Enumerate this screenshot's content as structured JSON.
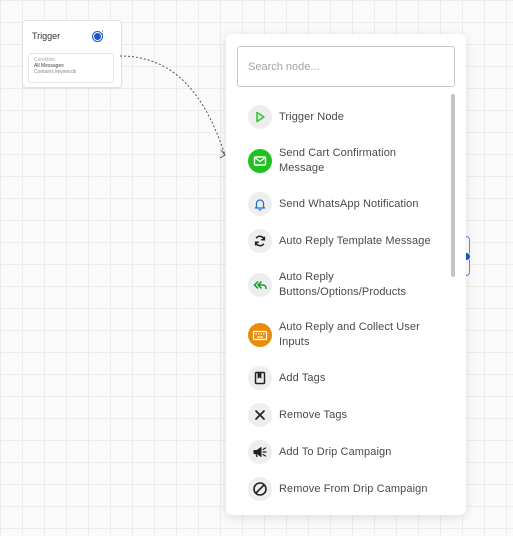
{
  "trigger_node": {
    "title": "Trigger",
    "menu_glyph": "⋮",
    "condition_label": "Condition",
    "condition_value": "All Messages",
    "condition_match": "Contains keywords"
  },
  "picker": {
    "search": {
      "placeholder": "Search node...",
      "value": ""
    },
    "items": [
      {
        "label": "Trigger Node",
        "icon": "play-icon",
        "icon_color": "#2ecc2e",
        "icon_bg": "#eeeeee"
      },
      {
        "label": "Send Cart Confirmation Message",
        "icon": "envelope-icon",
        "icon_color": "#ffffff",
        "icon_bg": "#22c122"
      },
      {
        "label": "Send WhatsApp Notification",
        "icon": "bell-icon",
        "icon_color": "#1f6fd6",
        "icon_bg": "#eeeeee"
      },
      {
        "label": "Auto Reply Template Message",
        "icon": "refresh-icon",
        "icon_color": "#222222",
        "icon_bg": "#eeeeee"
      },
      {
        "label": "Auto Reply Buttons/Options/Products",
        "icon": "reply-all-icon",
        "icon_color": "#139a2a",
        "icon_bg": "#eeeeee"
      },
      {
        "label": "Auto Reply and Collect User Inputs",
        "icon": "keyboard-icon",
        "icon_color": "#ffffff",
        "icon_bg": "#e88c0c"
      },
      {
        "label": "Add Tags",
        "icon": "tag-icon",
        "icon_color": "#222222",
        "icon_bg": "#eeeeee"
      },
      {
        "label": "Remove Tags",
        "icon": "close-icon",
        "icon_color": "#222222",
        "icon_bg": "#eeeeee"
      },
      {
        "label": "Add To Drip Campaign",
        "icon": "megaphone-icon",
        "icon_color": "#222222",
        "icon_bg": "#eeeeee"
      },
      {
        "label": "Remove From Drip Campaign",
        "icon": "block-icon",
        "icon_color": "#222222",
        "icon_bg": "#eeeeee"
      }
    ]
  }
}
